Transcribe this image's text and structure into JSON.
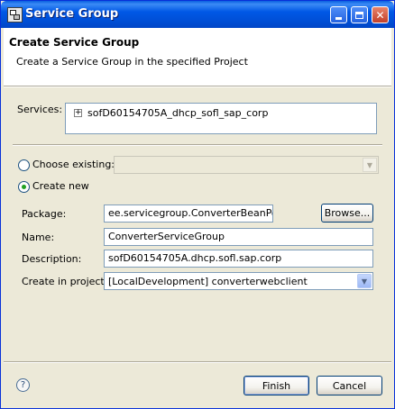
{
  "window": {
    "title": "Service Group",
    "controls": {
      "minimize": "minimize",
      "maximize": "maximize",
      "close": "✕"
    }
  },
  "header": {
    "title": "Create Service Group",
    "subtitle": "Create a Service Group in the specified Project"
  },
  "services": {
    "label": "Services:",
    "tree_items": [
      {
        "expander": "+",
        "label": "sofD60154705A_dhcp_sofl_sap_corp"
      }
    ]
  },
  "choose_existing": {
    "label": "Choose existing:",
    "selected": false,
    "value": ""
  },
  "create_new": {
    "label": "Create new",
    "selected": true
  },
  "form": {
    "package_label": "Package:",
    "package_value": "ee.servicegroup.ConverterBeanPort",
    "browse_label": "Browse...",
    "name_label": "Name:",
    "name_value": "ConverterServiceGroup",
    "description_label": "Description:",
    "description_value": "sofD60154705A.dhcp.sofl.sap.corp",
    "project_label": "Create in project:",
    "project_value": "[LocalDevelopment] converterwebclient"
  },
  "footer": {
    "help_icon": "?",
    "finish_label": "Finish",
    "cancel_label": "Cancel"
  },
  "icons": {
    "app": "service-group-icon",
    "dropdown": "chevron-down-icon",
    "help": "help-icon"
  }
}
